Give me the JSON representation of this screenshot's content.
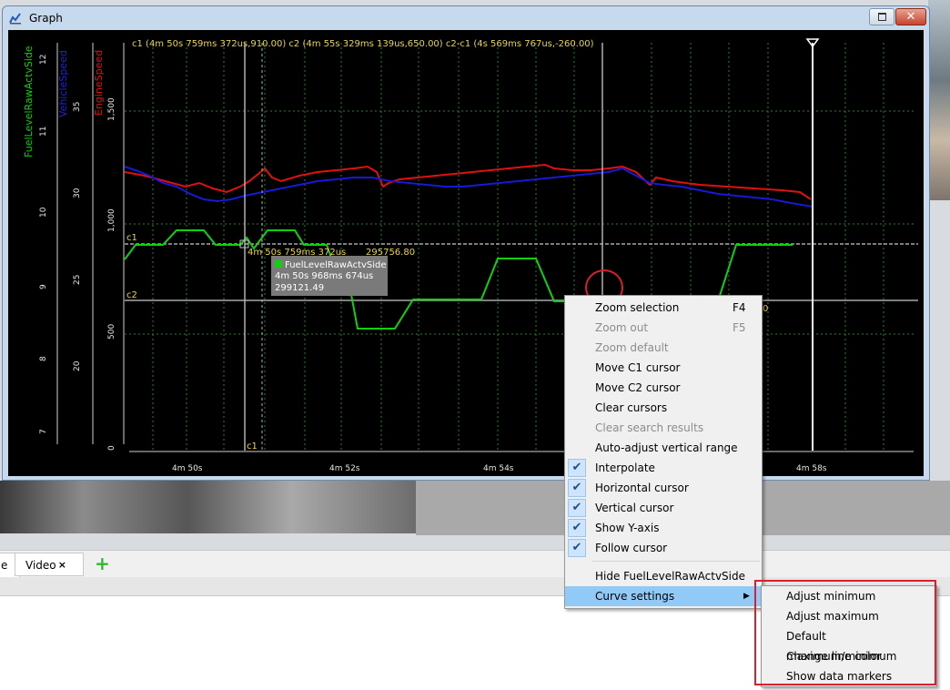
{
  "window": {
    "title": "Graph",
    "close_glyph": "✕"
  },
  "plot": {
    "cursor_info": "c1 (4m 50s 759ms 372us,910.00)  c2 (4m 55s 329ms 139us,650.00)  c2-c1 (4s 569ms 767us,-260.00)",
    "legend": {
      "fuel": "FuelLevelRawActvSide",
      "vehicle": "VehicleSpeed",
      "engine": "EngineSpeed"
    },
    "fuel_ticks": [
      "12",
      "11",
      "10",
      "9",
      "8",
      "7"
    ],
    "vehicle_ticks": [
      "35",
      "30",
      "25",
      "20"
    ],
    "engine_ticks": [
      "1,500",
      "1,000",
      "500",
      "0"
    ],
    "x_ticks": [
      "4m 50s",
      "4m 52s",
      "4m 54s",
      "4m 58s"
    ],
    "c1_label": "c1",
    "c2_label": "c2",
    "c1_bottom_label": "c1",
    "c1_marker_text": "4m 50s 759ms 372us",
    "c1_value_text": "295756.80",
    "c2_hidden_text": "0",
    "tooltip": {
      "series": "FuelLevelRawActvSide",
      "time": "4m 50s 968ms 674us",
      "value": "299121.49"
    },
    "colors": {
      "fuel": "#10d010",
      "vehicle": "#1010d8",
      "engine": "#e01010"
    }
  },
  "context_menu": {
    "items": [
      {
        "label": "Zoom selection",
        "shortcut": "F4",
        "enabled": true
      },
      {
        "label": "Zoom out",
        "shortcut": "F5",
        "enabled": false
      },
      {
        "label": "Zoom default",
        "enabled": false
      },
      {
        "label": "Move C1 cursor",
        "enabled": true
      },
      {
        "label": "Move C2 cursor",
        "enabled": true
      },
      {
        "label": "Clear cursors",
        "enabled": true
      },
      {
        "label": "Clear search results",
        "enabled": false
      },
      {
        "label": "Auto-adjust vertical range",
        "enabled": true
      },
      {
        "label": "Interpolate",
        "checked": true
      },
      {
        "label": "Horizontal cursor",
        "checked": true
      },
      {
        "label": "Vertical cursor",
        "checked": true
      },
      {
        "label": "Show Y-axis",
        "checked": true
      },
      {
        "label": "Follow cursor",
        "checked": true
      },
      {
        "label": "Hide FuelLevelRawActvSide"
      },
      {
        "label": "Curve settings",
        "has_submenu": true
      }
    ],
    "check_glyph": "✔",
    "submenu_arrow": "▶"
  },
  "submenu": {
    "items": [
      "Adjust minimum",
      "Adjust maximum",
      "Default maximum/minimum",
      "Change line color",
      "Show data markers"
    ]
  },
  "tabs": {
    "partial_label": "e",
    "video_label": "Video",
    "close_glyph": "×",
    "add_glyph": "+"
  }
}
